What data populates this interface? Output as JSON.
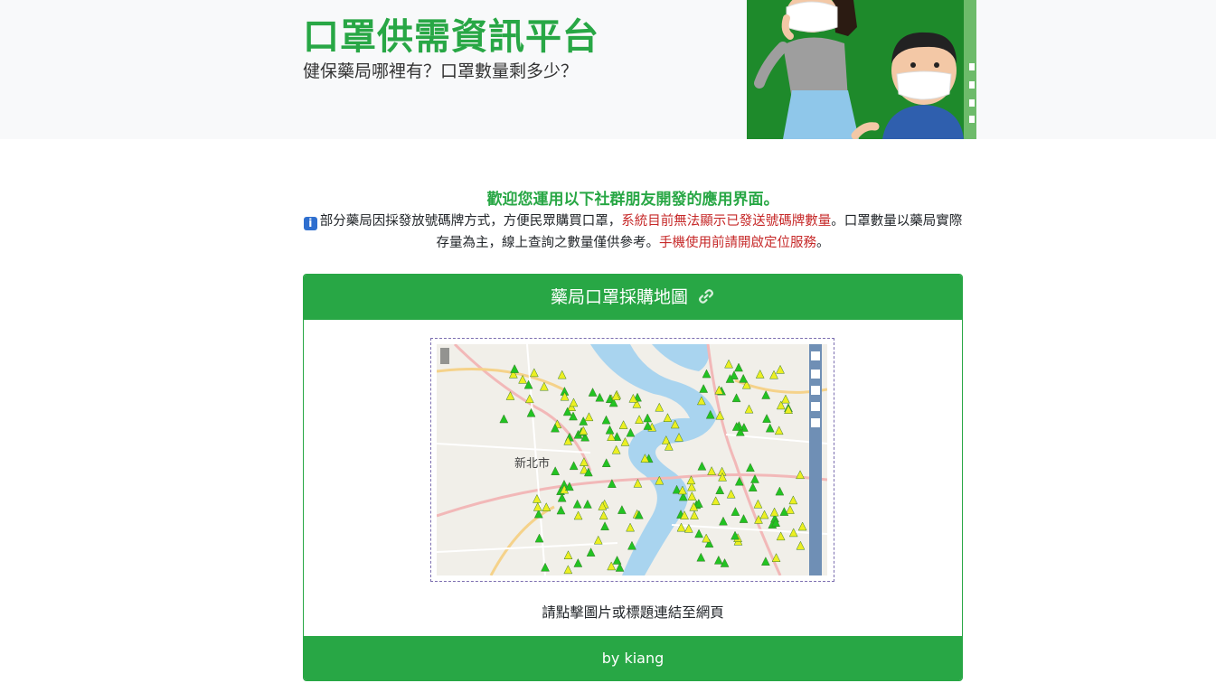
{
  "hero": {
    "title": "口罩供需資訊平台",
    "subtitle": "健保藥局哪裡有？口罩數量剩多少？"
  },
  "welcome": "歡迎您運用以下社群朋友開發的應用界面。",
  "notice": {
    "part1": "部分藥局因採發放號碼牌方式，方便民眾購買口罩，",
    "part2_red": "系統目前無法顯示已發送號碼牌數量",
    "part3": "。口罩數量以藥局實際存量為主，線上查詢之數量僅供參考。",
    "part4_red": "手機使用前請開啟定位服務",
    "part5": "。"
  },
  "card": {
    "title": "藥局口罩採購地圖",
    "map_label": "新北市",
    "caption": "請點擊圖片或標題連結至網頁",
    "footer": "by kiang"
  },
  "colors": {
    "brand_green": "#28a745",
    "alert_red": "#c62828"
  }
}
